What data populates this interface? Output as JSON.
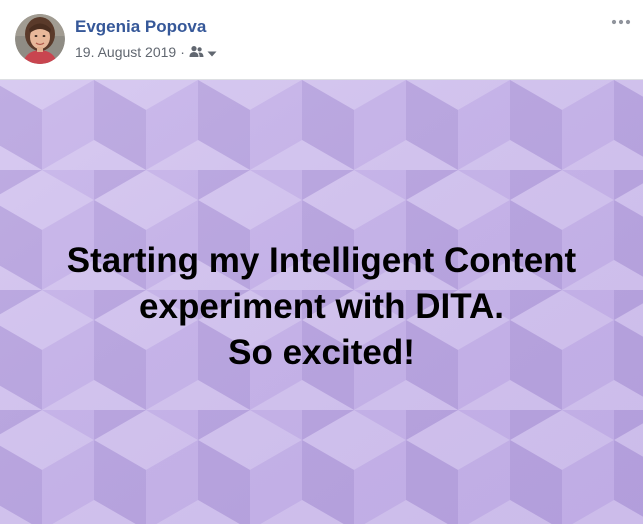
{
  "post": {
    "author": "Evgenia Popova",
    "date": "19. August 2019",
    "separator": "·",
    "audience_icon": "friends-icon",
    "more_icon": "ellipsis-icon",
    "text_lines": [
      "Starting my Intelligent Content",
      "experiment with DITA.",
      "So excited!"
    ]
  },
  "colors": {
    "author_link": "#365899",
    "meta_text": "#616770",
    "image_background": "#c4b1e6"
  }
}
